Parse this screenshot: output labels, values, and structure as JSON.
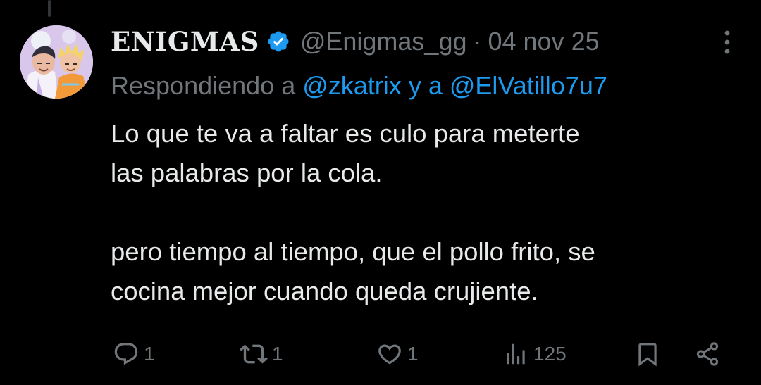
{
  "author": {
    "display_name": "ENIGMAS",
    "handle": "@Enigmas_gg",
    "separator": "·",
    "date": "04 nov 25",
    "verified": true
  },
  "reply_context": {
    "prefix": "Respondiendo a",
    "mention_1": "@zkatrix",
    "joiner": "y a",
    "mention_2": "@ElVatillo7u7"
  },
  "tweet": {
    "line_1": "Lo que te va a faltar es culo para meterte",
    "line_2": "las palabras por la cola.",
    "line_3": "pero tiempo al tiempo, que el pollo frito, se",
    "line_4": "cocina mejor cuando queda crujiente."
  },
  "metrics": {
    "replies": "1",
    "reposts": "1",
    "likes": "1",
    "views": "125"
  },
  "colors": {
    "background": "#000000",
    "text": "#e7e9ea",
    "secondary": "#71767b",
    "accent": "#1d9bf0",
    "verified_badge": "#1d9bf0"
  },
  "icons": {
    "more": "more-icon",
    "verified": "verified-badge-icon",
    "reply": "reply-icon",
    "repost": "repost-icon",
    "like": "heart-icon",
    "views": "views-chart-icon",
    "bookmark": "bookmark-icon",
    "share": "share-icon"
  }
}
